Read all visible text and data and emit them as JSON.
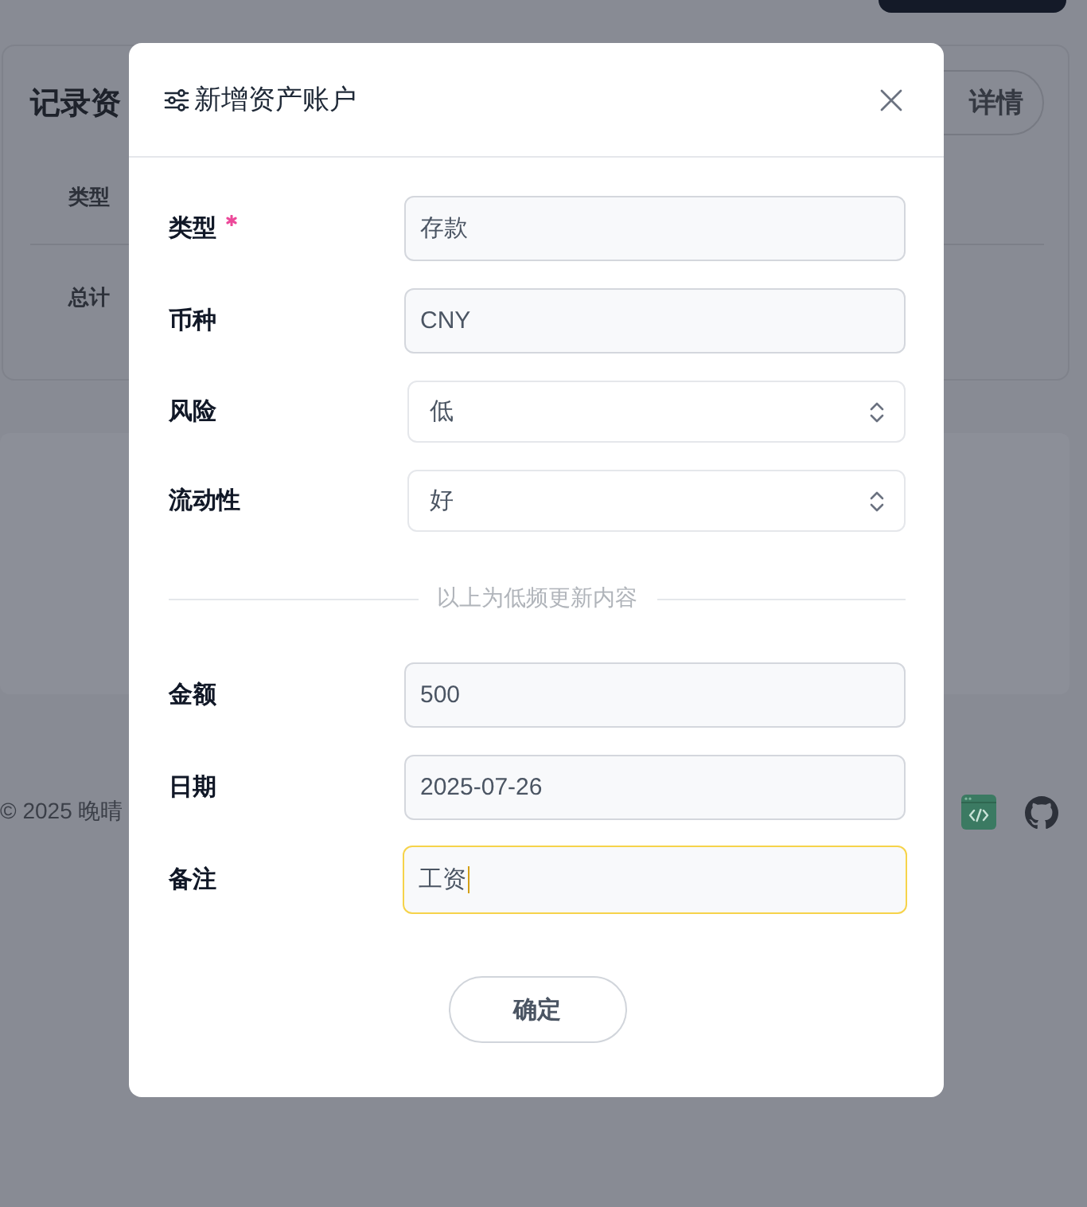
{
  "page": {
    "card": {
      "title": "记录资",
      "details_button": "详情",
      "table": {
        "columns": [
          "类型"
        ],
        "rows": [
          [
            "总计"
          ]
        ]
      }
    },
    "footer": {
      "copyright": "© 2025 晚晴"
    }
  },
  "dialog": {
    "title": "新增资产账户",
    "fields_top": [
      {
        "label": "类型",
        "required": true,
        "kind": "input",
        "value": "存款",
        "focused": false
      },
      {
        "label": "币种",
        "required": false,
        "kind": "input",
        "value": "CNY",
        "focused": false
      },
      {
        "label": "风险",
        "required": false,
        "kind": "select",
        "value": "低",
        "focused": false
      },
      {
        "label": "流动性",
        "required": false,
        "kind": "select",
        "value": "好",
        "focused": false
      }
    ],
    "divider_text": "以上为低频更新内容",
    "fields_bottom": [
      {
        "label": "金额",
        "required": false,
        "kind": "input",
        "value": "500",
        "focused": false
      },
      {
        "label": "日期",
        "required": false,
        "kind": "input",
        "value": "2025-07-26",
        "focused": false
      },
      {
        "label": "备注",
        "required": false,
        "kind": "input",
        "value": "工资",
        "focused": true
      }
    ],
    "confirm_button": "确定"
  }
}
